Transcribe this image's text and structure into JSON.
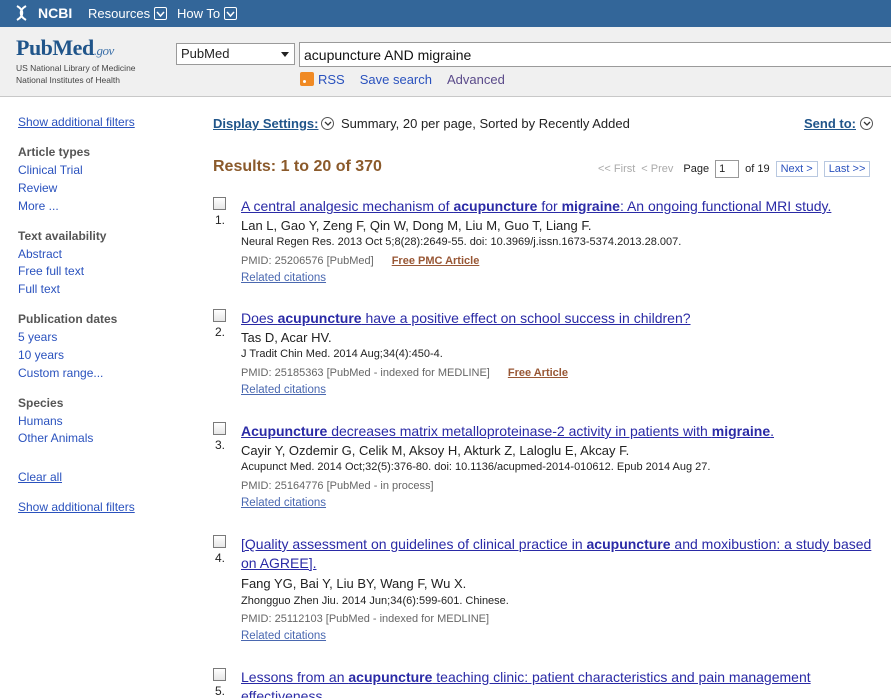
{
  "ncbi": {
    "logo_label": "NCBI",
    "menu": [
      {
        "label": "Resources"
      },
      {
        "label": "How To"
      }
    ]
  },
  "header": {
    "logo_word_pub": "Pub",
    "logo_word_med": "Med",
    "logo_word_gov": ".gov",
    "logo_sub1": "US National Library of Medicine",
    "logo_sub2": "National Institutes of Health",
    "database": "PubMed",
    "query": "acupuncture AND migraine",
    "links": {
      "rss": "RSS",
      "save": "Save search",
      "advanced": "Advanced"
    }
  },
  "sidebar": {
    "show_filters": "Show additional filters",
    "groups": [
      {
        "heading": "Article types",
        "items": [
          "Clinical Trial",
          "Review",
          "More ..."
        ]
      },
      {
        "heading": "Text availability",
        "items": [
          "Abstract",
          "Free full text",
          "Full text"
        ]
      },
      {
        "heading": "Publication dates",
        "items": [
          "5 years",
          "10 years",
          "Custom range..."
        ]
      },
      {
        "heading": "Species",
        "items": [
          "Humans",
          "Other Animals"
        ]
      }
    ],
    "clear_all": "Clear all",
    "show_filters_bottom": "Show additional filters"
  },
  "display": {
    "label": "Display Settings:",
    "summary": "Summary, 20 per page, Sorted by Recently Added",
    "send_to": "Send to:"
  },
  "results": {
    "count_text": "Results: 1 to 20 of 370",
    "pager": {
      "first": "<< First",
      "prev": "< Prev",
      "page_label": "Page",
      "page_value": "1",
      "of": "of 19",
      "next": "Next >",
      "last": "Last >>"
    },
    "items": [
      {
        "num": "1.",
        "title_parts": [
          {
            "t": "A central analgesic mechanism of "
          },
          {
            "t": "acupuncture",
            "b": true
          },
          {
            "t": " for "
          },
          {
            "t": "migraine",
            "b": true
          },
          {
            "t": ": An ongoing functional MRI study."
          }
        ],
        "authors": "Lan L, Gao Y, Zeng F, Qin W, Dong M, Liu M, Guo T, Liang F.",
        "source": "Neural Regen Res. 2013 Oct 5;8(28):2649-55. doi: 10.3969/j.issn.1673-5374.2013.28.007.",
        "pmid": "PMID: 25206576 [PubMed]",
        "free": "Free PMC Article",
        "related": "Related citations"
      },
      {
        "num": "2.",
        "title_parts": [
          {
            "t": "Does "
          },
          {
            "t": "acupuncture",
            "b": true
          },
          {
            "t": " have a positive effect on school success in children?"
          }
        ],
        "authors": "Tas D, Acar HV.",
        "source": "J Tradit Chin Med. 2014 Aug;34(4):450-4.",
        "pmid": "PMID: 25185363 [PubMed - indexed for MEDLINE]",
        "free": "Free Article",
        "related": "Related citations"
      },
      {
        "num": "3.",
        "title_parts": [
          {
            "t": "Acupuncture",
            "b": true
          },
          {
            "t": " decreases matrix metalloproteinase-2 activity in patients with "
          },
          {
            "t": "migraine",
            "b": true
          },
          {
            "t": "."
          }
        ],
        "authors": "Cayir Y, Ozdemir G, Celik M, Aksoy H, Akturk Z, Laloglu E, Akcay F.",
        "source": "Acupunct Med. 2014 Oct;32(5):376-80. doi: 10.1136/acupmed-2014-010612. Epub 2014 Aug 27.",
        "pmid": "PMID: 25164776 [PubMed - in process]",
        "free": "",
        "related": "Related citations"
      },
      {
        "num": "4.",
        "title_parts": [
          {
            "t": "[Quality assessment on guidelines of clinical practice in "
          },
          {
            "t": "acupuncture",
            "b": true
          },
          {
            "t": " and moxibustion: a study based on AGREE]."
          }
        ],
        "authors": "Fang YG, Bai Y, Liu BY, Wang F, Wu X.",
        "source": "Zhongguo Zhen Jiu. 2014 Jun;34(6):599-601. Chinese.",
        "pmid": "PMID: 25112103 [PubMed - indexed for MEDLINE]",
        "free": "",
        "related": "Related citations"
      },
      {
        "num": "5.",
        "title_parts": [
          {
            "t": "Lessons from an "
          },
          {
            "t": "acupuncture",
            "b": true
          },
          {
            "t": " teaching clinic: patient characteristics and pain management effectiveness"
          }
        ],
        "authors": "",
        "source": "",
        "pmid": "",
        "free": "",
        "related": ""
      }
    ]
  },
  "colors": {
    "ncbi_bar": "#336699",
    "link": "#2a2aa6",
    "results_count": "#8b5a2b",
    "free_article": "#985735"
  }
}
